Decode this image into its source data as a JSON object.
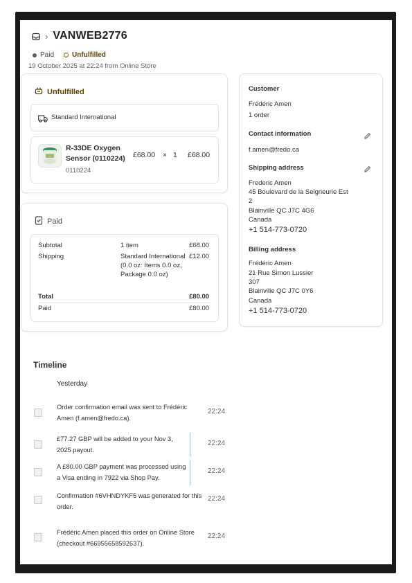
{
  "header": {
    "order_id": "VANWEB2776",
    "badge_paid": "Paid",
    "badge_unfulfilled": "Unfulfilled",
    "datetime": "19 October 2025 at 22:24 from Online Store"
  },
  "fulfillment": {
    "title": "Unfulfilled",
    "shipping_method": "Standard International",
    "product": {
      "name": "R-33DE Oxygen Sensor (0110224)",
      "sku": "0110224",
      "price": "£68.00",
      "multiply": "×",
      "qty": "1",
      "total": "£68.00"
    }
  },
  "payment": {
    "title": "Paid",
    "subtotal_label": "Subtotal",
    "subtotal_desc": "1 item",
    "subtotal_amount": "£68.00",
    "shipping_label": "Shipping",
    "shipping_desc": "Standard International (0.0 oz: Items 0.0 oz, Package 0.0 oz)",
    "shipping_amount": "£12.00",
    "total_label": "Total",
    "total_amount": "£80.00",
    "paid_label": "Paid",
    "paid_amount": "£80.00"
  },
  "customer": {
    "title": "Customer",
    "name": "Frédéric Amen",
    "orders": "1 order",
    "contact_title": "Contact information",
    "email": "f.amen@fredo.ca",
    "shipping_title": "Shipping address",
    "shipping_lines": [
      "Frederic Amen",
      "45 Boulevard de la Seigneurie Est",
      "2",
      "Blainville QC J7C 4G6",
      "Canada"
    ],
    "shipping_phone": "+1 514-773-0720",
    "billing_title": "Billing address",
    "billing_lines": [
      "Frédéric Amen",
      "21 Rue Simon Lussier",
      "307",
      "Blainville QC J7C 0Y6",
      "Canada"
    ],
    "billing_phone": "+1 514-773-0720"
  },
  "timeline": {
    "title": "Timeline",
    "day": "Yesterday",
    "events": [
      {
        "text": "Order confirmation email was sent to Frédéric Amen (f.amen@fredo.ca).",
        "time": "22:24"
      },
      {
        "text": "£77.27 GBP will be added to your Nov 3, 2025 payout.",
        "time": "22:24"
      },
      {
        "text": "A £80.00 GBP payment was processed using a Visa ending in 7922 via Shop Pay.",
        "time": "22:24"
      },
      {
        "text": "Confirmation #6VHNDYKF5 was generated for this order.",
        "time": "22:24"
      },
      {
        "text": "Frédéric Amen placed this order on Online Store (checkout #66955658592637).",
        "time": "22:24"
      }
    ]
  },
  "colors": {
    "unfulfilled": "#5e4200",
    "border": "#e3e3e3",
    "text": "#303030",
    "muted": "#616161"
  }
}
